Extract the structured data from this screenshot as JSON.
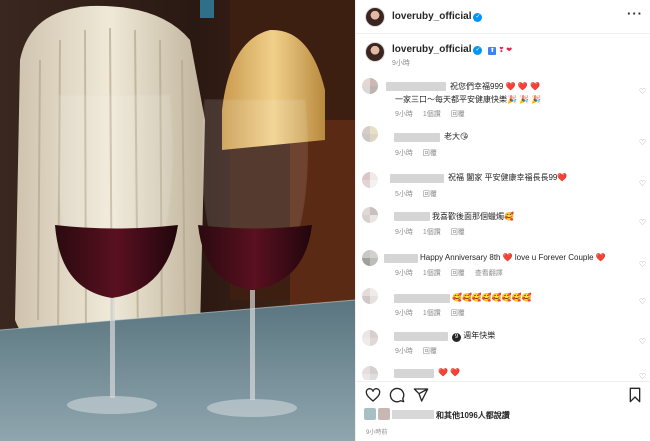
{
  "post": {
    "username": "loveruby_official",
    "caption_time": "9小時",
    "colors": {
      "verified": "#0095f6",
      "heart": "#ed1c4a",
      "muted": "#8e8e8e"
    }
  },
  "comments": [
    {
      "text": "祝您們幸福999",
      "hearts": "❤️ ❤️ ❤️",
      "text2": "一家三口～每天都平安健康快樂🎉 🎉 🎉",
      "time": "9小時",
      "likes": "1個讚",
      "reply": "回覆"
    },
    {
      "text": "老大😘",
      "time": "9小時",
      "reply": "回覆"
    },
    {
      "text": "祝福 闔家 平安健康幸福長長99❤️",
      "time": "5小時",
      "reply": "回覆"
    },
    {
      "text": "我喜歡後面那個蠟燭🥰",
      "time": "9小時",
      "likes": "1個讚",
      "reply": "回覆"
    },
    {
      "text": "Happy Anniversary 8th ❤️ love u Forever Couple ❤️",
      "time": "9小時",
      "likes": "1個讚",
      "reply": "回覆",
      "translate": "查看翻譯"
    },
    {
      "text": "🥰🥰🥰🥰🥰🥰🥰🥰",
      "time": "9小時",
      "likes": "1個讚",
      "reply": "回覆"
    },
    {
      "text": "週年快樂",
      "badge": "9",
      "time": "9小時",
      "reply": "回覆"
    },
    {
      "text": "❤️ ❤️"
    }
  ],
  "footer": {
    "likes_text": "和其他1096人都說讚",
    "time": "9小時前"
  },
  "icons": [
    "heart-icon",
    "comment-icon",
    "share-icon",
    "bookmark-icon",
    "more-icon",
    "verified-icon"
  ]
}
